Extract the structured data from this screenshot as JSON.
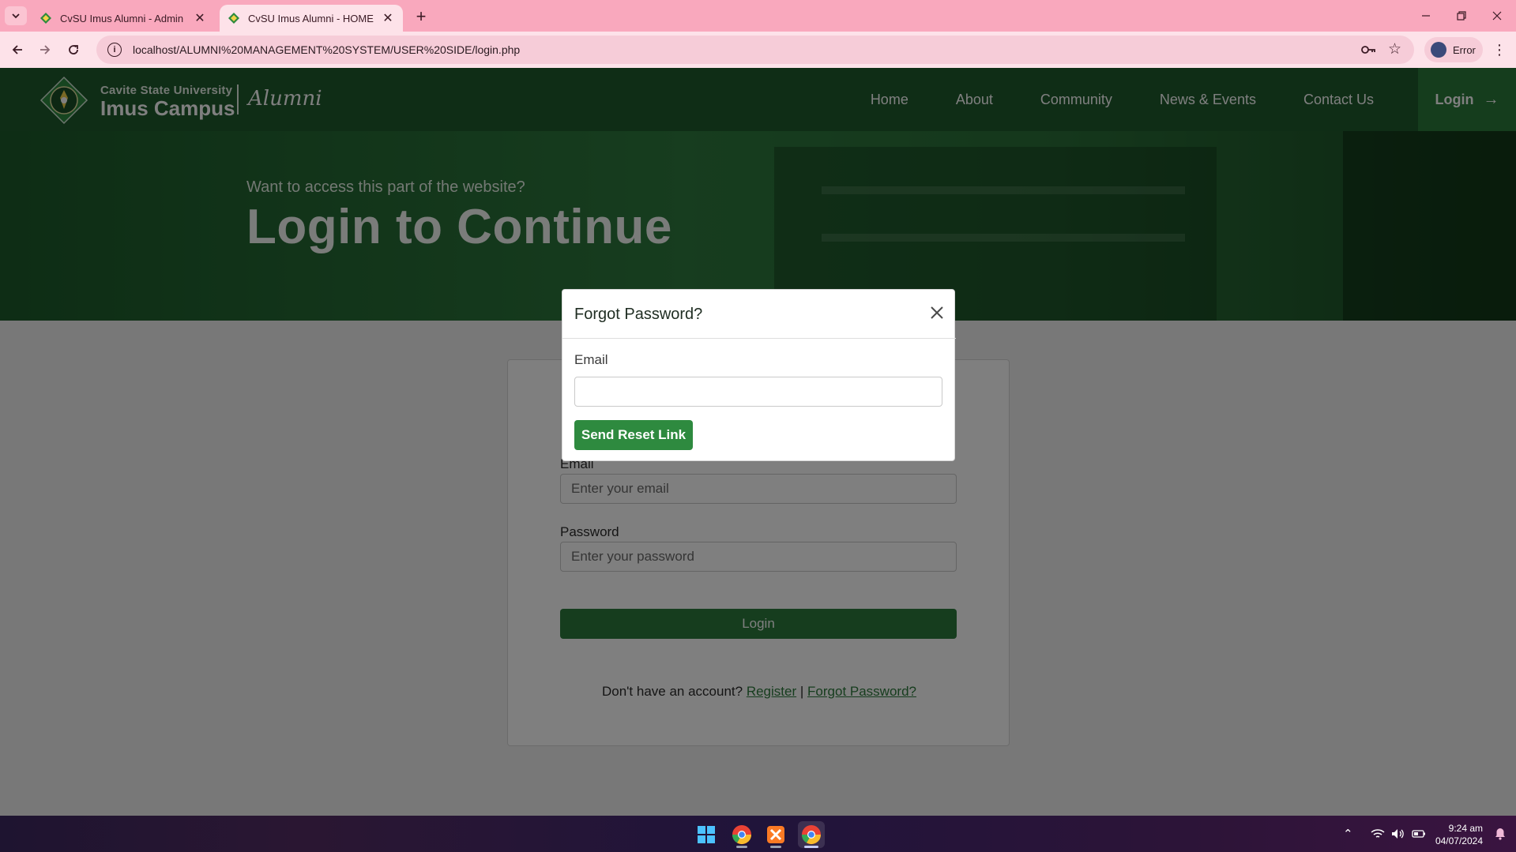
{
  "browser": {
    "tabs": [
      {
        "title": "CvSU Imus Alumni - Admin",
        "active": false
      },
      {
        "title": "CvSU Imus Alumni - HOME",
        "active": true
      }
    ],
    "url": "localhost/ALUMNI%20MANAGEMENT%20SYSTEM/USER%20SIDE/login.php",
    "profile_label": "Error",
    "accent_color": "#f9a8bd"
  },
  "site": {
    "brand_top": "Cavite State University",
    "brand_main": "Imus Campus",
    "brand_script": "Alumni",
    "nav": [
      "Home",
      "About",
      "Community",
      "News & Events",
      "Contact Us"
    ],
    "login_label": "Login",
    "primary_color": "#1e5b2c"
  },
  "hero": {
    "subtitle": "Want to access this part of the website?",
    "title": "Login to Continue"
  },
  "login_form": {
    "email_label": "Email",
    "email_placeholder": "Enter your email",
    "password_label": "Password",
    "password_placeholder": "Enter your password",
    "submit_label": "Login",
    "footer_prefix": "Don't have an account?",
    "register_label": "Register",
    "separator": "|",
    "forgot_label": "Forgot Password?"
  },
  "modal": {
    "title": "Forgot Password?",
    "email_label": "Email",
    "email_value": "",
    "submit_label": "Send Reset Link"
  },
  "taskbar": {
    "apps": [
      "windows-start-icon",
      "chrome-icon",
      "xampp-icon",
      "chrome-dev-icon"
    ],
    "time": "9:24 am",
    "date": "04/07/2024"
  }
}
